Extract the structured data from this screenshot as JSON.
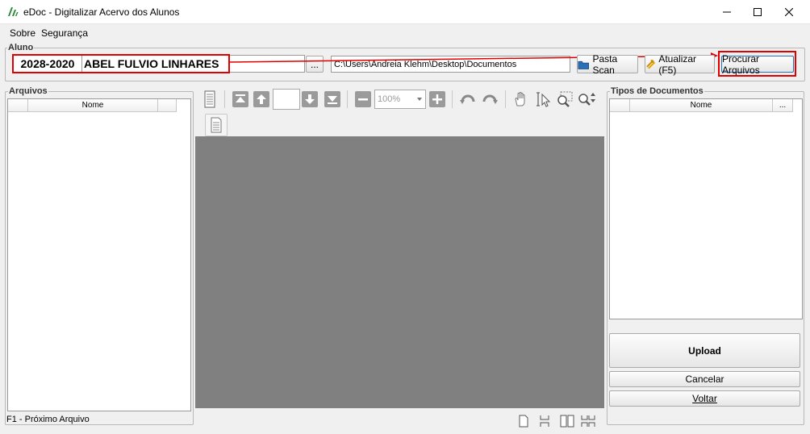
{
  "window": {
    "title": "eDoc - Digitalizar Acervo dos Alunos"
  },
  "menu": {
    "sobre": "Sobre",
    "seguranca": "Segurança"
  },
  "aluno": {
    "group_label": "Aluno",
    "matricula": "2028-2020",
    "nome": "ABEL FULVIO LINHARES",
    "browse_label": "...",
    "path": "C:\\Users\\Andreia Klehm\\Desktop\\Documentos",
    "pasta_scan_label": "Pasta Scan",
    "atualizar_label": "Atualizar (F5)",
    "procurar_label": "Procurar Arquivos"
  },
  "arquivos": {
    "group_label": "Arquivos",
    "column_nome": "Nome",
    "status": "F1 - Próximo Arquivo"
  },
  "viewer": {
    "zoom": "100%"
  },
  "tipos": {
    "group_label": "Tipos de Documentos",
    "column_nome": "Nome",
    "column_more": "...",
    "upload_label": "Upload",
    "cancelar_label": "Cancelar",
    "voltar_label": "Voltar"
  },
  "colors": {
    "highlight": "#e00000",
    "viewer_bg": "#808080",
    "window_bg": "#f0f0f0"
  }
}
